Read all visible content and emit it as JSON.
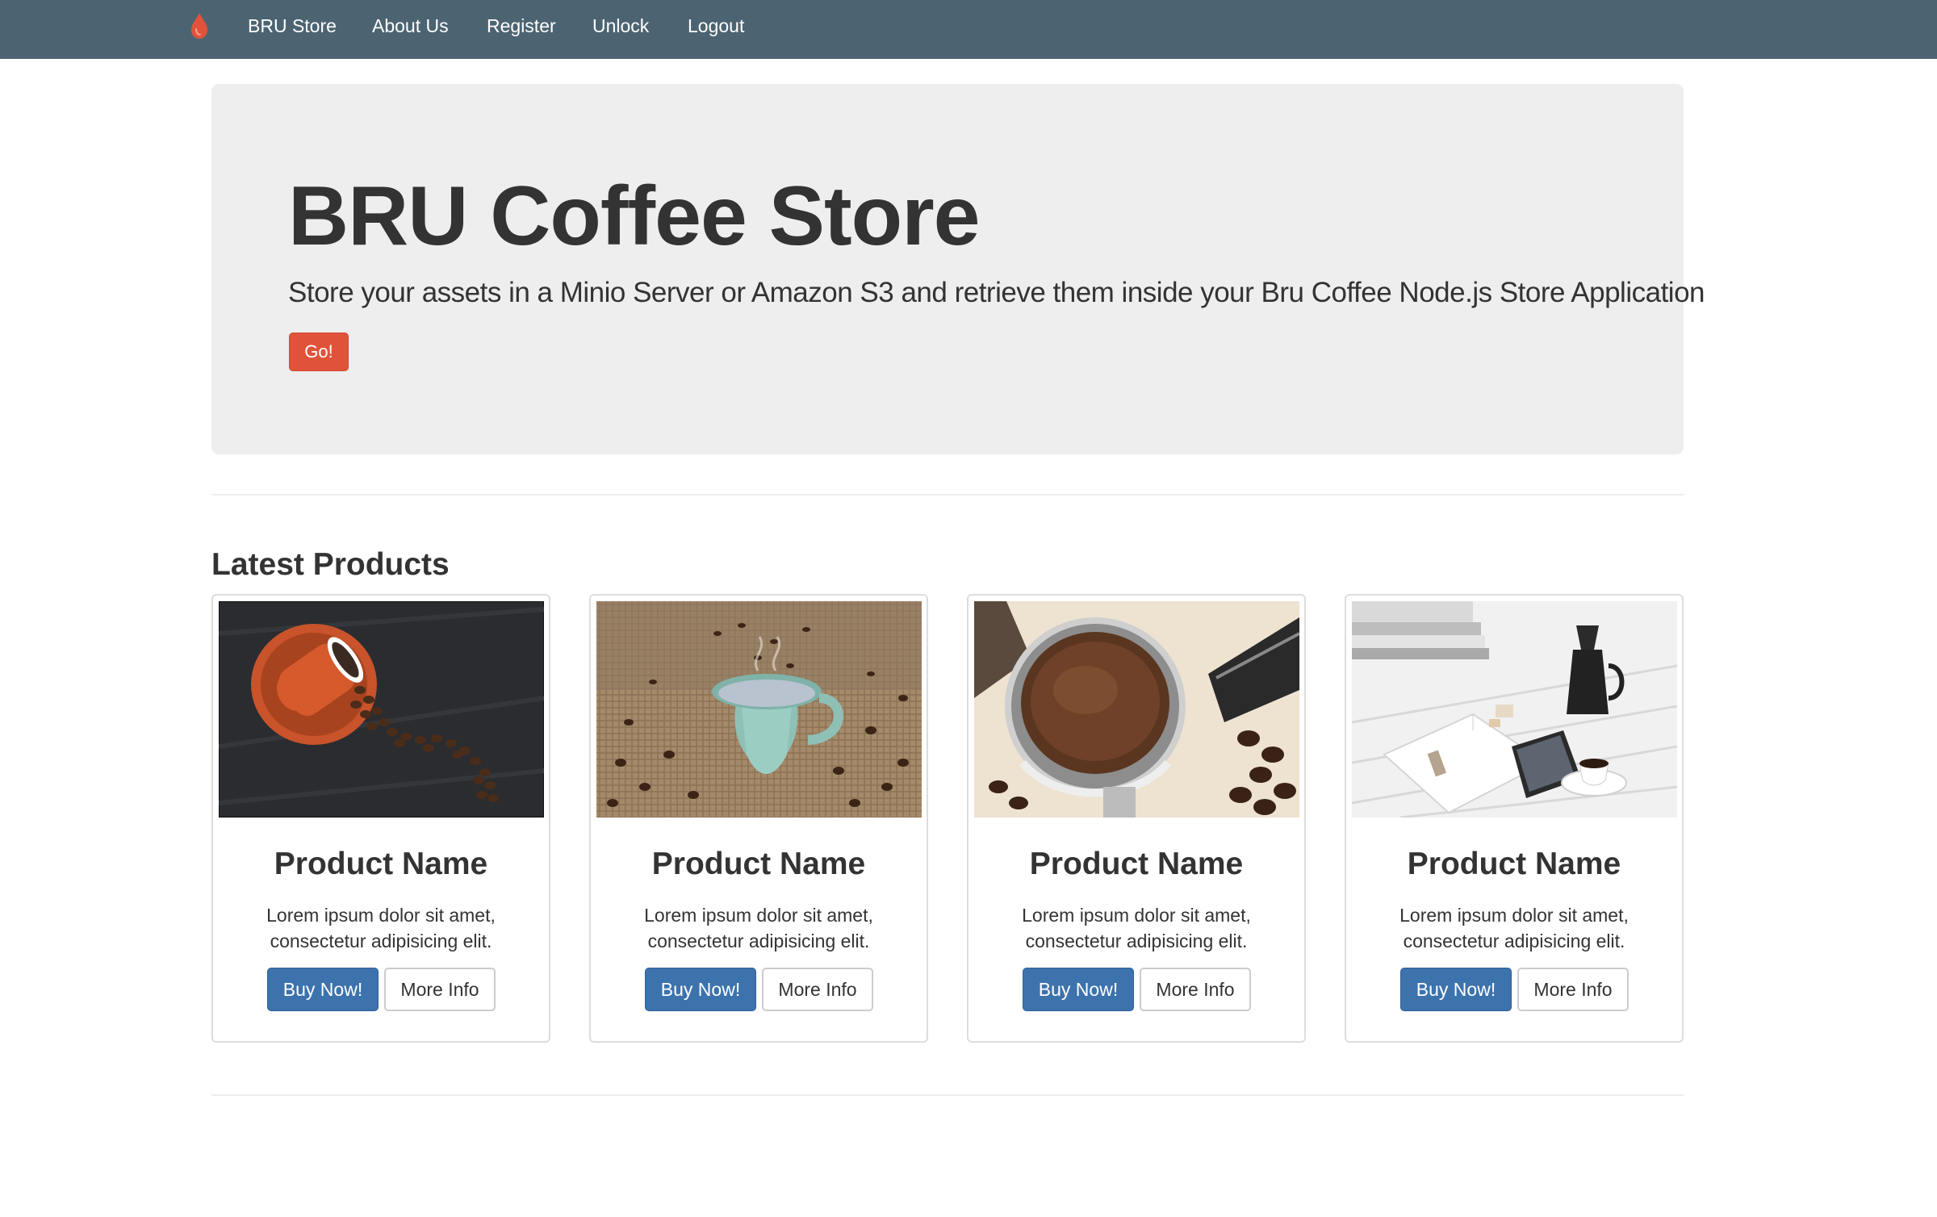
{
  "navbar": {
    "brand_icon": "drop-icon",
    "brand_color": "#e0533a",
    "background": "#4c6472",
    "links": [
      "BRU Store",
      "About Us",
      "Register",
      "Unlock",
      "Logout"
    ]
  },
  "hero": {
    "title": "BRU Coffee Store",
    "subtitle": "Store your assets in a Minio Server or Amazon S3 and retrieve them inside your Bru Coffee Node.js Store Application",
    "button_label": "Go!",
    "button_color": "#e0533a"
  },
  "products_section": {
    "title": "Latest Products",
    "products": [
      {
        "image": "spilled-coffee-cup-photo",
        "name": "Product Name",
        "description": "Lorem ipsum dolor sit amet, consectetur adipisicing elit.",
        "buy_label": "Buy Now!",
        "info_label": "More Info"
      },
      {
        "image": "coffee-mug-on-burlap-photo",
        "name": "Product Name",
        "description": "Lorem ipsum dolor sit amet, consectetur adipisicing elit.",
        "buy_label": "Buy Now!",
        "info_label": "More Info"
      },
      {
        "image": "espresso-portafilter-photo",
        "name": "Product Name",
        "description": "Lorem ipsum dolor sit amet, consectetur adipisicing elit.",
        "buy_label": "Buy Now!",
        "info_label": "More Info"
      },
      {
        "image": "desk-with-tablet-and-coffee-photo",
        "name": "Product Name",
        "description": "Lorem ipsum dolor sit amet, consectetur adipisicing elit.",
        "buy_label": "Buy Now!",
        "info_label": "More Info"
      }
    ],
    "buy_button_color": "#3d73ad"
  }
}
